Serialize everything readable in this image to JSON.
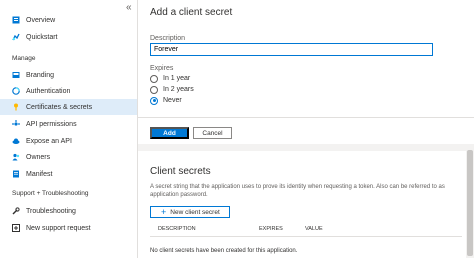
{
  "sidebar": {
    "collapse_glyph": "«",
    "items_top": [
      {
        "label": "Overview",
        "icon": "overview-icon"
      },
      {
        "label": "Quickstart",
        "icon": "quickstart-icon"
      }
    ],
    "section_manage": "Manage",
    "items_manage": [
      {
        "label": "Branding",
        "icon": "branding-icon"
      },
      {
        "label": "Authentication",
        "icon": "authentication-icon"
      },
      {
        "label": "Certificates & secrets",
        "icon": "key-icon",
        "selected": true
      },
      {
        "label": "API permissions",
        "icon": "api-permissions-icon"
      },
      {
        "label": "Expose an API",
        "icon": "cloud-icon"
      },
      {
        "label": "Owners",
        "icon": "owners-icon"
      },
      {
        "label": "Manifest",
        "icon": "manifest-icon"
      }
    ],
    "section_support": "Support + Troubleshooting",
    "items_support": [
      {
        "label": "Troubleshooting",
        "icon": "wrench-icon"
      },
      {
        "label": "New support request",
        "icon": "support-request-icon"
      }
    ]
  },
  "panel": {
    "title": "Add a client secret",
    "description_label": "Description",
    "description_value": "Forever",
    "expires_label": "Expires",
    "options": [
      "In 1 year",
      "In 2 years",
      "Never"
    ],
    "selected_option": "Never",
    "add_label": "Add",
    "cancel_label": "Cancel"
  },
  "client_secrets": {
    "title": "Client secrets",
    "description": "A secret string that the application uses to prove its identity when requesting a token. Also can be referred to as application password.",
    "new_button": "New client secret",
    "columns": [
      "DESCRIPTION",
      "EXPIRES",
      "VALUE"
    ],
    "empty_message": "No client secrets have been created for this application."
  },
  "colors": {
    "accent": "#0078d4",
    "selected_bg": "#deecf9"
  }
}
